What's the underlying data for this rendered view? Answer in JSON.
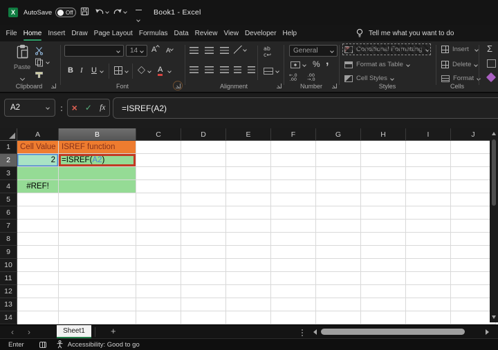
{
  "titlebar": {
    "logo_letter": "X",
    "autosave": "AutoSave",
    "autosave_state": "Off",
    "document_title": "Book1  -  Excel"
  },
  "menu": {
    "tabs": [
      "File",
      "Home",
      "Insert",
      "Draw",
      "Page Layout",
      "Formulas",
      "Data",
      "Review",
      "View",
      "Developer",
      "Help"
    ],
    "active_tab": "Home",
    "tell_me": "Tell me what you want to do"
  },
  "ribbon": {
    "clipboard": {
      "group": "Clipboard",
      "paste": "Paste"
    },
    "font": {
      "group": "Font",
      "font_size": "14",
      "bold": "B",
      "italic": "I",
      "underline": "U",
      "letter": "A"
    },
    "alignment": {
      "group": "Alignment"
    },
    "number": {
      "group": "Number",
      "format": "General",
      "percent": "%",
      "comma": ",",
      "inc_top": "←.0",
      "inc_bot": ".00",
      "dec_top": ".00",
      "dec_bot": "→.0"
    },
    "styles": {
      "group": "Styles",
      "conditional": "Conditional Formatting",
      "format_table": "Format as Table",
      "cell_styles": "Cell Styles"
    },
    "cells": {
      "group": "Cells",
      "insert": "Insert",
      "delete": "Delete",
      "format": "Format"
    },
    "editing": {
      "autosum": "Σ"
    }
  },
  "formula_bar": {
    "name_box": "A2",
    "cancel": "×",
    "enter_mark": "✓",
    "fx": "fx",
    "formula": "=ISREF(A2)"
  },
  "grid": {
    "columns": [
      "A",
      "B",
      "C",
      "D",
      "E",
      "F",
      "G",
      "H",
      "I",
      "J"
    ],
    "row_count": 14,
    "selection": {
      "column": "B",
      "row": 2,
      "edited_cell": "B2",
      "referenced_cell": "A2"
    },
    "colors": {
      "orange": "#EE7C2F",
      "orange_text": "#86301A",
      "green": "#95DB95",
      "teal": "#A9E3C4",
      "annotation_red": "#C23A23",
      "reference_blue": "#4D83D1"
    },
    "cells": [
      {
        "ref": "A1",
        "text": "Cell Value",
        "fill": "orange",
        "color": "orange_text"
      },
      {
        "ref": "B1",
        "text": "ISREF function",
        "fill": "orange",
        "color": "orange_text"
      },
      {
        "ref": "A2",
        "text": "2",
        "fill": "teal",
        "align": "right",
        "reference_highlight": true
      },
      {
        "ref": "B2",
        "formula_parts": [
          "=ISREF(",
          "A2",
          ")"
        ],
        "fill": "green",
        "annotation_box": true
      },
      {
        "ref": "A3",
        "fill": "green"
      },
      {
        "ref": "B3",
        "fill": "green"
      },
      {
        "ref": "A4",
        "text": "#REF!",
        "fill": "green",
        "align": "center"
      },
      {
        "ref": "B4",
        "fill": "green"
      }
    ]
  },
  "sheet_bar": {
    "prev": "‹",
    "next": "›",
    "tab": "Sheet1",
    "add": "+"
  },
  "status_bar": {
    "mode": "Enter",
    "accessibility": "Accessibility: Good to go"
  }
}
